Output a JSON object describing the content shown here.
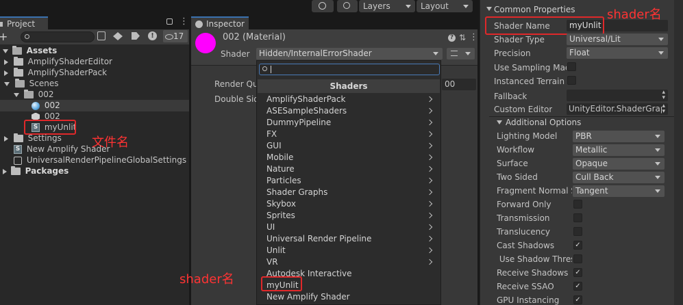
{
  "toolbar": {
    "layers_label": "Layers",
    "layout_label": "Layout"
  },
  "project": {
    "tab_label": "Project",
    "hidden_count": "17",
    "tree": {
      "assets": "Assets",
      "amplify_editor": "AmplifyShaderEditor",
      "amplify_pack": "AmplifyShaderPack",
      "scenes": "Scenes",
      "folder_002": "002",
      "item_002_a": "002",
      "item_002_b": "002",
      "myunlit": "myUnlit",
      "settings": "Settings",
      "new_amplify": "New Amplify Shader",
      "urp_global": "UniversalRenderPipelineGlobalSettings",
      "packages": "Packages"
    },
    "annotation": "文件名"
  },
  "inspector": {
    "tab_label": "Inspector",
    "material_name": "002 (Material)",
    "shader_label": "Shader",
    "shader_value": "Hidden/InternalErrorShader",
    "render_queue_label": "Render Qu",
    "render_queue_value": "00",
    "double_sided_label": "Double Sid",
    "material_color": "#ff00ff"
  },
  "popup": {
    "header": "Shaders",
    "items": [
      {
        "label": "AmplifyShaderPack",
        "submenu": true
      },
      {
        "label": "ASESampleShaders",
        "submenu": true
      },
      {
        "label": "DummyPipeline",
        "submenu": true
      },
      {
        "label": "FX",
        "submenu": true
      },
      {
        "label": "GUI",
        "submenu": true
      },
      {
        "label": "Mobile",
        "submenu": true
      },
      {
        "label": "Nature",
        "submenu": true
      },
      {
        "label": "Particles",
        "submenu": true
      },
      {
        "label": "Shader Graphs",
        "submenu": true
      },
      {
        "label": "Skybox",
        "submenu": true
      },
      {
        "label": "Sprites",
        "submenu": true
      },
      {
        "label": "UI",
        "submenu": true
      },
      {
        "label": "Universal Render Pipeline",
        "submenu": true
      },
      {
        "label": "Unlit",
        "submenu": true
      },
      {
        "label": "VR",
        "submenu": true
      },
      {
        "label": "Autodesk Interactive",
        "submenu": false
      },
      {
        "label": "myUnlit",
        "submenu": false
      },
      {
        "label": "New Amplify Shader",
        "submenu": false
      }
    ],
    "annotation": "shader名"
  },
  "right": {
    "common_props": "Common Properties",
    "annotation": "shader名",
    "shader_name_label": "Shader Name",
    "shader_name_value": "myUnlit",
    "shader_type_label": "Shader Type",
    "shader_type_value": "Universal/Lit",
    "precision_label": "Precision",
    "precision_value": "Float",
    "use_sampling_label": "Use Sampling Mac",
    "instanced_terrain_label": "Instanced Terrain",
    "fallback_label": "Fallback",
    "custom_editor_label": "Custom Editor",
    "custom_editor_value": "UnityEditor.ShaderGrap",
    "additional_options": "Additional Options",
    "rows": [
      {
        "label": "Lighting Model",
        "value": "PBR",
        "kind": "dropdown"
      },
      {
        "label": "Workflow",
        "value": "Metallic",
        "kind": "dropdown"
      },
      {
        "label": "Surface",
        "value": "Opaque",
        "kind": "dropdown"
      },
      {
        "label": "Two Sided",
        "value": "Cull Back",
        "kind": "dropdown"
      },
      {
        "label": "Fragment Normal Sp",
        "value": "Tangent",
        "kind": "dropdown"
      },
      {
        "label": "Forward Only",
        "value": "",
        "kind": "check"
      },
      {
        "label": "Transmission",
        "value": "",
        "kind": "check"
      },
      {
        "label": "Translucency",
        "value": "",
        "kind": "check"
      },
      {
        "label": "Cast Shadows",
        "value": "✓",
        "kind": "check"
      },
      {
        "label": " Use Shadow Thres",
        "value": "",
        "kind": "check"
      },
      {
        "label": "Receive Shadows",
        "value": "✓",
        "kind": "check"
      },
      {
        "label": "Receive SSAO",
        "value": "✓",
        "kind": "check"
      },
      {
        "label": "GPU Instancing",
        "value": "✓",
        "kind": "check"
      }
    ]
  }
}
